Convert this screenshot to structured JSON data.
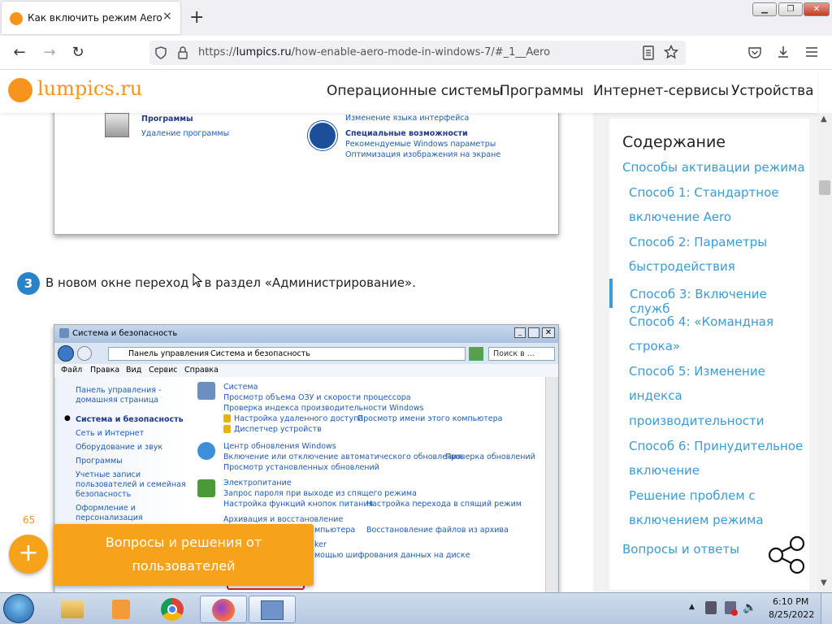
{
  "browser": {
    "tab_title": "Как включить режим Aero в W",
    "url_prefix": "https://",
    "url_domain": "lumpics.ru",
    "url_path": "/how-enable-aero-mode-in-windows-7/#_1__Aero",
    "new_tab": "+",
    "tab_close": "×"
  },
  "site": {
    "logo_text": "lumpics.ru",
    "menu": [
      "Операционные системы",
      "Программы",
      "Интернет-сервисы",
      "Устройства"
    ]
  },
  "screenshot_top": {
    "left_links": [
      "Программы",
      "Удаление программы"
    ],
    "right_links": [
      "Изменение языка интерфейса",
      "Специальные возможности",
      "Рекомендуемые Windows параметры",
      "Оптимизация изображения на экране"
    ]
  },
  "step": {
    "number": "3",
    "text": "В новом окне переходи к в раздел «Администрирование».",
    "text_display": "В новом окне переход    в раздел «Администрирование»."
  },
  "win_screenshot": {
    "title": "Система и безопасность",
    "breadcrumb": [
      "Панель управления",
      "Система и безопасность"
    ],
    "search_placeholder": "Поиск в ...",
    "menu": [
      "Файл",
      "Правка",
      "Вид",
      "Сервис",
      "Справка"
    ],
    "sidebar": [
      "Панель управления -",
      "домашняя страница",
      "Система и безопасность",
      "Сеть и Интернет",
      "Оборудование и звук",
      "Программы",
      "Учетные записи",
      "пользователей и семейная",
      "безопасность",
      "Оформление и",
      "персонализация"
    ],
    "sections": [
      {
        "title": "Система",
        "links": [
          "Просмотр объема ОЗУ и скорости процессора",
          "Проверка индекса производительности Windows",
          "Настройка удаленного доступа",
          "Просмотр имени этого компьютера",
          "Диспетчер устройств"
        ]
      },
      {
        "title": "Центр обновления Windows",
        "links": [
          "Включение или отключение автоматического обновления",
          "Проверка обновлений",
          "Просмотр установленных обновлений"
        ]
      },
      {
        "title": "Электропитание",
        "links": [
          "Запрос пароля при выходе из спящего режима",
          "Настройка функций кнопок питания",
          "Настройка перехода в спящий режим"
        ]
      },
      {
        "title": "Архивация и восстановление",
        "links": [
          "мпьютера",
          "Восстановление файлов из архива"
        ]
      },
      {
        "title": "ker",
        "links": [
          "мощью шифрования данных на диске"
        ]
      }
    ]
  },
  "float": {
    "counter": "65",
    "plus": "+",
    "banner_line1": "Вопросы и решения от",
    "banner_line2": "пользователей"
  },
  "toc": {
    "title": "Содержание",
    "items": [
      "Способы активации режима",
      "Способ 1: Стандартное",
      "включение Aero",
      "Способ 2: Параметры",
      "быстродействия",
      "Способ 3: Включение служб",
      "Способ 4: «Командная",
      "строка»",
      "Способ 5: Изменение",
      "индекса",
      "производительности",
      "Способ 6: Принудительное",
      "включение",
      "Решение проблем с",
      "включением режима",
      "Вопросы и ответы"
    ],
    "accent": "#3a9bd5"
  },
  "taskbar": {
    "time": "6:10 PM",
    "date": "8/25/2022"
  },
  "colors": {
    "brand_orange": "#f7941d",
    "link_blue": "#3a9bd5",
    "step_badge": "#2a82c9"
  }
}
